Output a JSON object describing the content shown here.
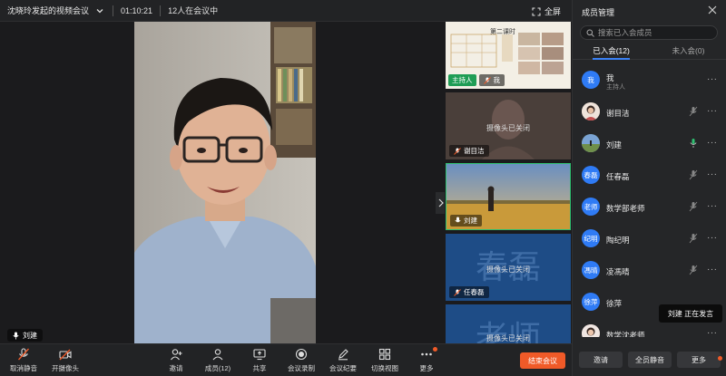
{
  "topbar": {
    "title": "沈晓玲发起的视频会议",
    "duration": "01:10:21",
    "participants_text": "12人在会议中",
    "fullscreen_label": "全屏"
  },
  "main": {
    "speaker_name": "刘建"
  },
  "thumbnails": [
    {
      "name": "我",
      "badge": "主持人",
      "camera_off": false,
      "share_title": "第二课时"
    },
    {
      "name": "谢目洁",
      "badge": "",
      "camera_off": true,
      "camera_off_text": "摄像头已关闭"
    },
    {
      "name": "刘建",
      "badge": "",
      "camera_off": false,
      "active": true
    },
    {
      "name": "任春磊",
      "badge": "",
      "camera_off": true,
      "camera_off_text": "摄像头已关闭",
      "bg_text": "春磊"
    },
    {
      "name": "",
      "badge": "",
      "camera_off": true,
      "camera_off_text": "摄像头已关闭",
      "bg_text": "老师"
    }
  ],
  "panel": {
    "title": "成员管理",
    "search_placeholder": "搜索已入会成员",
    "tabs": [
      {
        "label": "已入会(12)",
        "active": true
      },
      {
        "label": "未入会(0)",
        "active": false
      }
    ],
    "members": [
      {
        "name": "我",
        "role": "主持人",
        "avatar_text": "我",
        "avatar_color": "#2f7bf5"
      },
      {
        "name": "谢目洁",
        "role": "",
        "avatar_text": "",
        "avatar_color": "#c9a48b"
      },
      {
        "name": "刘建",
        "role": "",
        "avatar_text": "",
        "avatar_color": "#6a8f5a",
        "speaking": true
      },
      {
        "name": "任春磊",
        "role": "",
        "avatar_text": "春磊",
        "avatar_color": "#2f7bf5"
      },
      {
        "name": "数学部老师",
        "role": "",
        "avatar_text": "老师",
        "avatar_color": "#2f7bf5"
      },
      {
        "name": "陶纪明",
        "role": "",
        "avatar_text": "纪明",
        "avatar_color": "#2f7bf5"
      },
      {
        "name": "凌馮晴",
        "role": "",
        "avatar_text": "馮晴",
        "avatar_color": "#2f7bf5"
      },
      {
        "name": "徐萍",
        "role": "",
        "avatar_text": "徐萍",
        "avatar_color": "#2f7bf5"
      },
      {
        "name": "数学沈老师",
        "role": "",
        "avatar_text": "",
        "avatar_color": "#d7b7b0"
      }
    ],
    "footer": {
      "invite": "邀请",
      "mute_all": "全员静音",
      "more": "更多"
    },
    "tooltip": "刘建  正在发言"
  },
  "toolbar": {
    "unmute": "取消静音",
    "camera": "开摄像头",
    "invite": "邀请",
    "members": "成员(12)",
    "share": "共享",
    "record": "会议录制",
    "minutes": "会议纪要",
    "switch_view": "切换视图",
    "more": "更多",
    "end": "结束会议"
  },
  "colors": {
    "accent": "#3b82f6",
    "end_button": "#f05a28",
    "host_badge": "#1f9d55",
    "active_border": "#2fbf71"
  }
}
